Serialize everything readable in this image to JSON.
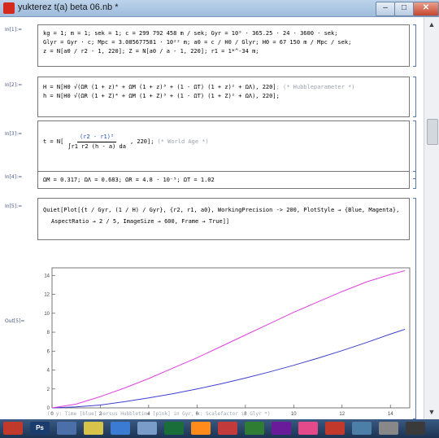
{
  "window": {
    "title": "yukterez t(a) beta 06.nb *"
  },
  "cells": {
    "in1": {
      "label": "In[1]:=",
      "line1": "kg = 1;  m = 1;  sek = 1;  c = 299 792 458 m / sek;  Gyr = 10⁹ · 365.25 · 24 · 3600 · sek;",
      "line2": "Glyr = Gyr · c;  Mpc = 3.085677581 · 10²² m;  a0 = c / H0 / Glyr;  H0 = 67 150 m / Mpc / sek;",
      "line3": "z = N[a0 / r2 - 1, 220];  Z = N[a0 / a - 1, 220];  r1 = 1*^-34 m;"
    },
    "in2": {
      "label": "In[2]:=",
      "line1": "H = N[H0 √(ΩR (1 + z)⁴ + ΩM (1 + z)³ + (1 - ΩT) (1 + z)² + ΩΛ), 220]",
      "line1_comment": ";  (* Hubbleparameter *)",
      "line2": "h = N[H0 √(ΩR (1 + Z)⁴ + ΩM (1 + Z)³ + (1 - ΩT) (1 + Z)² + ΩΛ), 220];"
    },
    "in3": {
      "label": "In[3]:=",
      "prefix": "t = N[",
      "numerator": "(r2 - r1)²",
      "denominator": "∫r1 r2 (h - a) da",
      "suffix": ", 220];",
      "comment": "(* World Age *)"
    },
    "in4": {
      "label": "In[4]:=",
      "line1": "ΩM = 0.317;  ΩΛ = 0.683;  ΩR = 4.8 · 10⁻⁵;  ΩT = 1.02"
    },
    "in5": {
      "label": "In[5]:=",
      "line1": "Quiet[Plot[{t / Gyr, (1 / H) / Gyr}, {r2, r1, a0}, WorkingPrecision -> 200, PlotStyle → {Blue, Magenta},",
      "line2": "AspectRatio → 2 / 5, ImageSize → 600, Frame → True]]"
    },
    "out5": {
      "label": "Out[5]=",
      "caption": "(* y: Time [blue] versus Hubbletime [pink] in Gyr, x: Scalefactor in Glyr *)"
    }
  },
  "chart_data": {
    "type": "line",
    "title": "",
    "xlabel": "",
    "ylabel": "",
    "xlim": [
      0,
      14.8
    ],
    "ylim": [
      0,
      14.8
    ],
    "x_ticks": [
      0,
      2,
      4,
      6,
      8,
      10,
      12,
      14
    ],
    "y_ticks": [
      0,
      2,
      4,
      6,
      8,
      10,
      12,
      14
    ],
    "grid": false,
    "series": [
      {
        "color": "#3f3fcf",
        "x": [
          0,
          1,
          2,
          3,
          4,
          5,
          6,
          7,
          8,
          9,
          10,
          11,
          12,
          13,
          14,
          14.6
        ],
        "y": [
          0,
          0.1,
          0.3,
          0.65,
          1.05,
          1.5,
          2.0,
          2.55,
          3.15,
          3.8,
          4.5,
          5.25,
          6.05,
          6.9,
          7.8,
          8.3
        ]
      },
      {
        "color": "#e040e0",
        "x": [
          0,
          1,
          2,
          3,
          4,
          5,
          6,
          7,
          8,
          9,
          10,
          11,
          12,
          13,
          14,
          14.6
        ],
        "y": [
          0,
          0.4,
          1.2,
          2.1,
          3.1,
          4.2,
          5.3,
          6.5,
          7.7,
          8.9,
          10.1,
          11.2,
          12.3,
          13.3,
          14.1,
          14.5
        ]
      }
    ]
  },
  "taskbar": {
    "items": [
      "",
      "Ps",
      "",
      "",
      "",
      "",
      "",
      "",
      "",
      "",
      "",
      "",
      "",
      "",
      "",
      ""
    ],
    "colors": [
      "#c0392b",
      "#1b3d6e",
      "#4b6fa8",
      "#d8c34a",
      "#3b7bd1",
      "#7a9cc8",
      "#1a6e3a",
      "#ff8c1a",
      "#c23a3a",
      "#2e7d32",
      "#6a1b9a",
      "#e44a8a",
      "#c0392b",
      "#4d7ea8",
      "#888888",
      "#3a3a3a"
    ]
  }
}
